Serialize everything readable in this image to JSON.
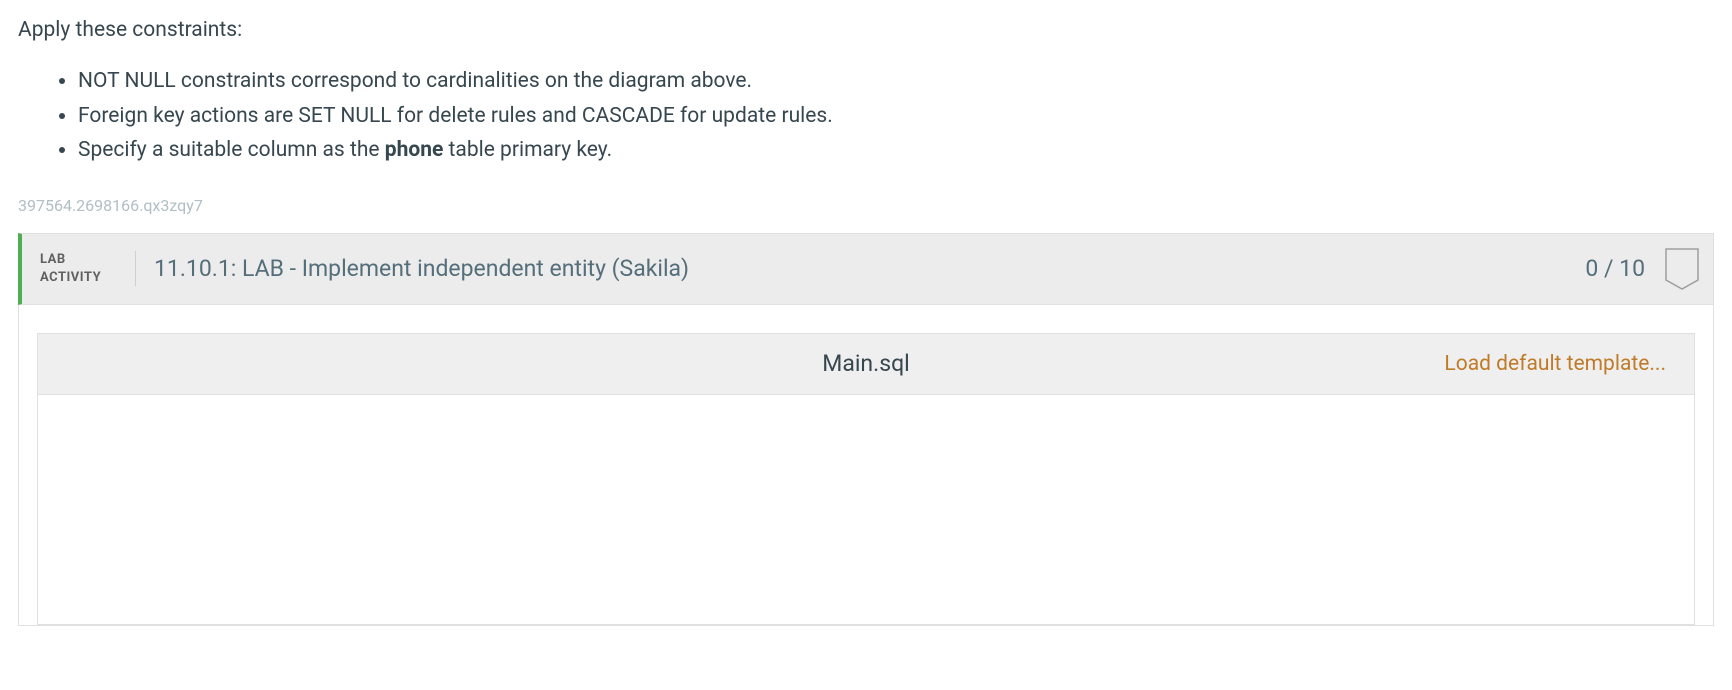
{
  "instructions": {
    "intro": "Apply these constraints:",
    "items": [
      {
        "text": "NOT NULL constraints correspond to cardinalities on the diagram above."
      },
      {
        "text": "Foreign key actions are SET NULL for delete rules and CASCADE for update rules."
      },
      {
        "prefix": "Specify a suitable column as the ",
        "bold": "phone",
        "suffix": " table primary key."
      }
    ]
  },
  "tracking_id": "397564.2698166.qx3zqy7",
  "lab": {
    "label_line1": "LAB",
    "label_line2": "ACTIVITY",
    "title": "11.10.1: LAB - Implement independent entity (Sakila)",
    "score": "0 / 10"
  },
  "editor": {
    "filename": "Main.sql",
    "load_template": "Load default template..."
  }
}
